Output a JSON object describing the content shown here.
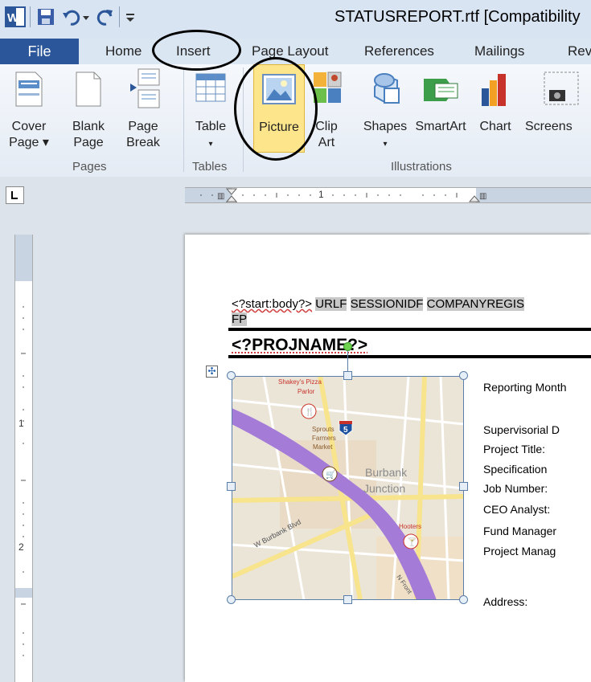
{
  "window": {
    "title": "STATUSREPORT.rtf [Compatibility"
  },
  "quick_access": [
    "word-logo-icon",
    "save-icon",
    "undo-icon",
    "redo-icon",
    "customize-icon"
  ],
  "ribbon_tabs": {
    "file": "File",
    "home": "Home",
    "insert": "Insert",
    "page_layout": "Page Layout",
    "references": "References",
    "mailings": "Mailings",
    "review": "Rev"
  },
  "ribbon": {
    "cover_page": [
      "Cover",
      "Page ▾"
    ],
    "blank_page": [
      "Blank",
      "Page"
    ],
    "page_break": [
      "Page",
      "Break"
    ],
    "table": "Table",
    "picture": "Picture",
    "clip_art": [
      "Clip",
      "Art"
    ],
    "shapes": "Shapes",
    "smartart": "SmartArt",
    "chart": "Chart",
    "screenshot": "Screens",
    "groups": {
      "pages": "Pages",
      "tables": "Tables",
      "illustrations": "Illustrations"
    }
  },
  "ruler": {
    "marks": [
      "1",
      "2"
    ]
  },
  "document": {
    "body_tag": "<?start:body?>",
    "fields_line": [
      "URLF",
      "SESSIONIDF",
      "COMPANYREGIS"
    ],
    "fields_line2": "FP",
    "project_name": "<?PROJNAME?>",
    "labels": [
      "Reporting Month",
      "Supervisorial D",
      "Project Title:",
      "Specification",
      "Job Number:",
      "CEO Analyst:",
      "Fund Manager",
      "Project Manag",
      "Address:"
    ]
  },
  "map": {
    "places": [
      "Shakey's Pizza",
      "Parlor",
      "Sprouts",
      "Farmers",
      "Market",
      "Burbank",
      "Junction",
      "Hooters",
      "W Burbank Blvd",
      "N Front",
      "5"
    ]
  },
  "colors": {
    "file_tab": "#2b579a",
    "picture_highlight": "#fde58b",
    "freeway": "#a57bd8"
  }
}
